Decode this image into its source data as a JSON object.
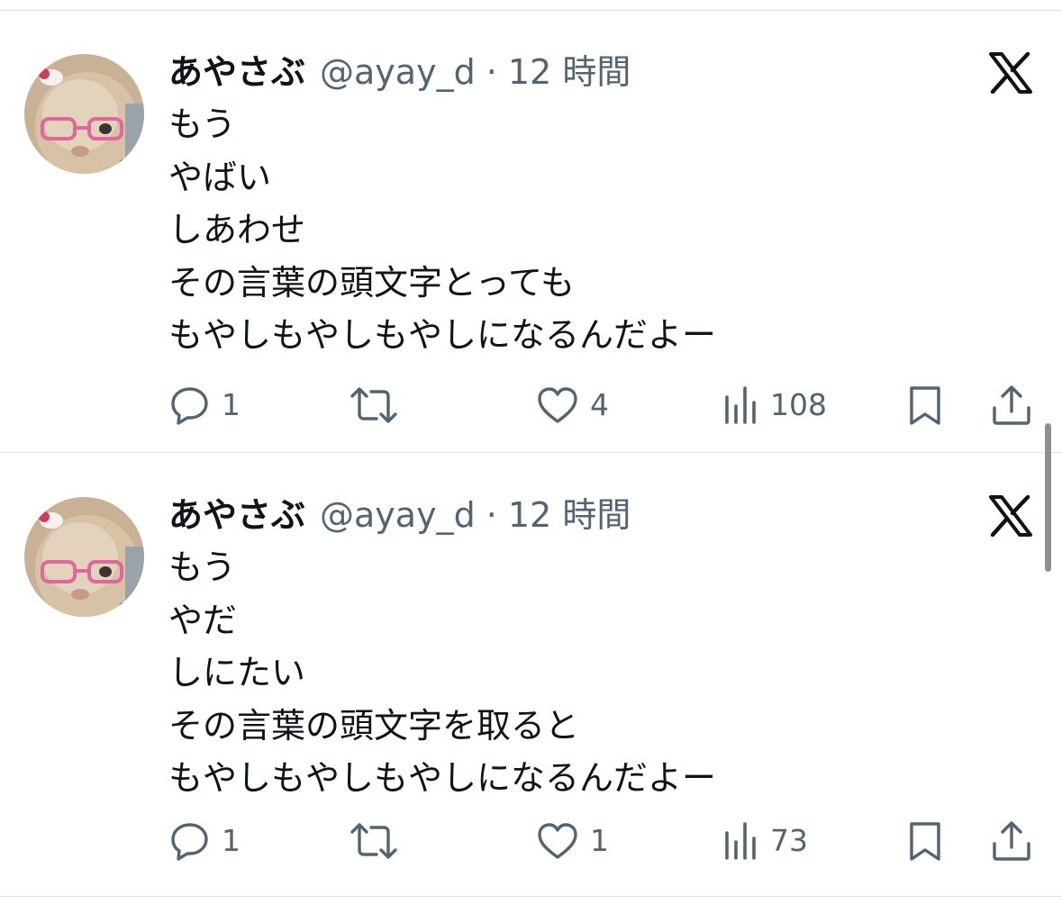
{
  "tweets": [
    {
      "display_name": "あやさぶ",
      "handle_time": "@ayay_d · 12 時間",
      "lines": [
        "もう",
        "やばい",
        "しあわせ",
        "その言葉の頭文字とっても",
        "もやしもやしもやしになるんだよー"
      ],
      "replies": "1",
      "likes": "4",
      "views": "108"
    },
    {
      "display_name": "あやさぶ",
      "handle_time": "@ayay_d · 12 時間",
      "lines": [
        "もう",
        "やだ",
        "しにたい",
        "その言葉の頭文字を取ると",
        "もやしもやしもやしになるんだよー"
      ],
      "replies": "1",
      "likes": "1",
      "views": "73"
    }
  ],
  "icons": {
    "reply": "reply-icon",
    "retweet": "retweet-icon",
    "like": "heart-icon",
    "views": "views-icon",
    "bookmark": "bookmark-icon",
    "share": "share-icon",
    "brand": "x-logo-icon"
  },
  "colors": {
    "text": "#0f1419",
    "secondary": "#536471",
    "divider": "#dfe3e6"
  }
}
